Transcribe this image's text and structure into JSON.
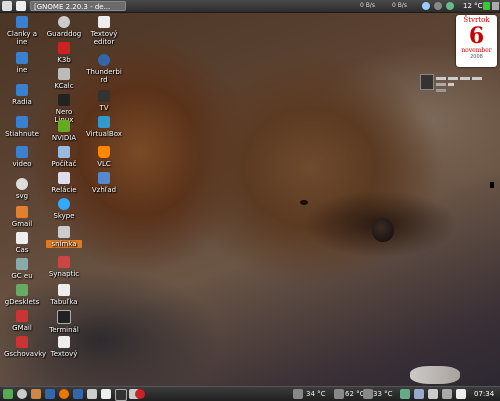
{
  "top_panel": {
    "task_title": "[GNOME 2.20.3 - de...",
    "net_down": "0 B/s",
    "net_up": "0 B/s",
    "temperature": "12 °C",
    "icons": [
      "menu-icon",
      "terminal-icon",
      "network-icon",
      "weather-icon",
      "battery-icon",
      "volume-icon"
    ]
  },
  "desktop": {
    "col1": [
      "Clanky a\nine",
      "ine",
      "Radia",
      "Stiahnute",
      "video",
      "svg",
      "Gmail",
      "Cas",
      "GC eu",
      "gDesklets",
      "GMail",
      "Gschovavky"
    ],
    "col2": [
      "Guarddog",
      "K3b",
      "KCalc",
      "Nero Linux",
      "NVIDIA",
      "Počítač",
      "Relácie",
      "Skype",
      "snímka",
      "Synaptic",
      "Tabuľka",
      "Terminál",
      "Textový"
    ],
    "col3": [
      "Textový\neditor",
      "Thunderbi\nrd",
      "TV",
      "VirtualBox",
      "VLC",
      "Vzhľad"
    ]
  },
  "calendar": {
    "day": "Štvrtok",
    "number": "6",
    "month": "november",
    "year": "2008"
  },
  "bottom_panel": {
    "temps": [
      "34 °C",
      "62 °C",
      "33 °C"
    ],
    "clock": "07:34"
  },
  "colors": {
    "selected_label": "#e07a20",
    "calendar_red": "#c00"
  }
}
